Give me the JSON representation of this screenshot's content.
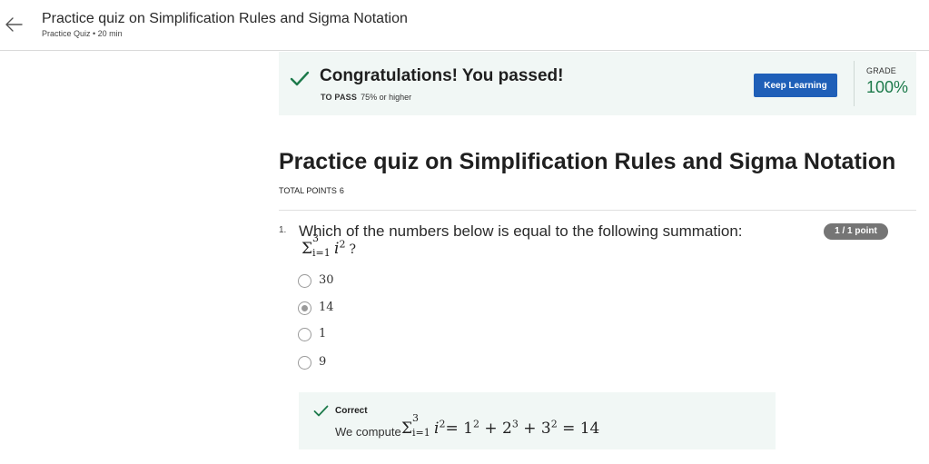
{
  "header": {
    "title": "Practice quiz on Simplification Rules and Sigma Notation",
    "subtitle": "Practice Quiz • 20 min",
    "back_icon": "back-arrow-icon"
  },
  "banner": {
    "title": "Congratulations! You passed!",
    "to_pass_label": "TO PASS",
    "to_pass_value": "75% or higher",
    "keep_learning_label": "Keep Learning",
    "grade_label": "GRADE",
    "grade_value": "100%",
    "accent_color": "#1d7a4b",
    "button_color": "#1f5fb8"
  },
  "quiz": {
    "title": "Practice quiz on Simplification Rules and Sigma Notation",
    "total_points_label": "TOTAL POINTS",
    "total_points_value": "6"
  },
  "question": {
    "number": "1.",
    "text": "Which of the numbers below is equal to the following summation:",
    "math": {
      "sigma": "Σ",
      "upper": "3",
      "lower": "i=1",
      "term": "i",
      "exponent": "2",
      "suffix": "?"
    },
    "points_badge": "1 / 1 point",
    "options": [
      {
        "label": "30",
        "selected": false
      },
      {
        "label": "14",
        "selected": true
      },
      {
        "label": "1",
        "selected": false
      },
      {
        "label": "9",
        "selected": false
      }
    ]
  },
  "feedback": {
    "title": "Correct",
    "text": "We compute",
    "math": {
      "sigma": "Σ",
      "upper": "3",
      "lower": "i=1",
      "term": "i",
      "exponent": "2",
      "expansion": "= 1",
      "e1": "2",
      "plus1": " + 2",
      "e2": "3",
      "plus2": " + 3",
      "e3": "2",
      "result": " = 14"
    }
  }
}
